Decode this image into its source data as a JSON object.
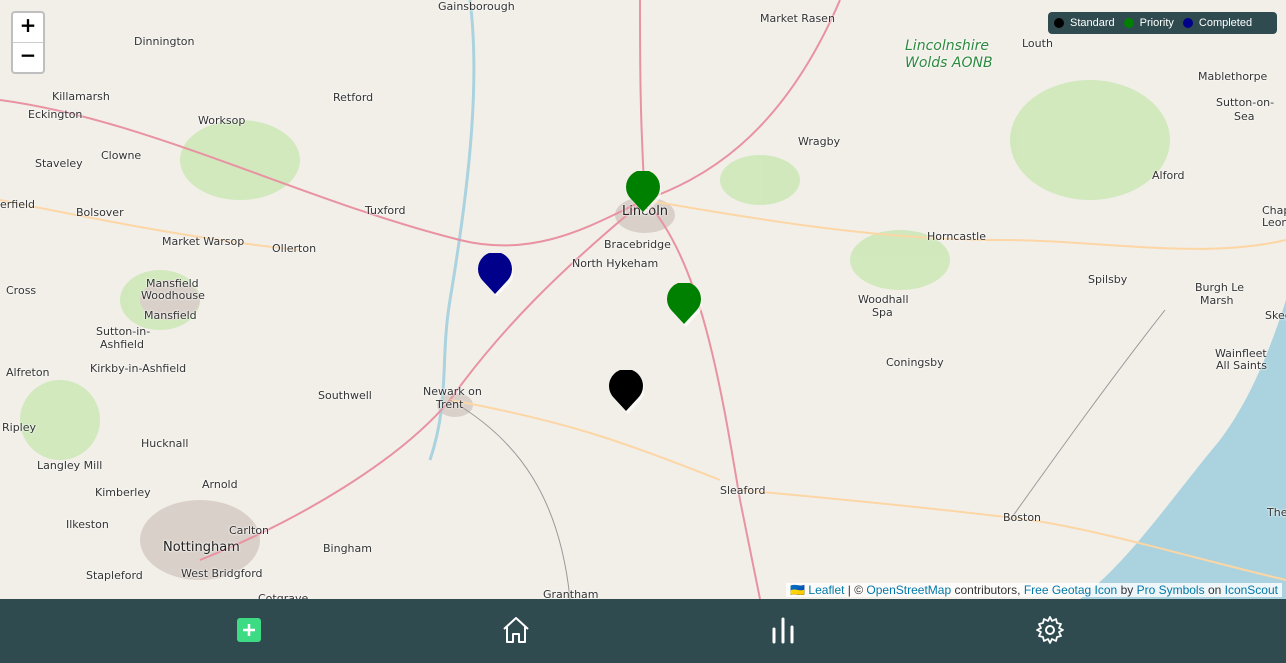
{
  "map": {
    "zoom_in": "+",
    "zoom_out": "−",
    "places": [
      {
        "name": "Gainsborough",
        "cls": ""
      },
      {
        "name": "Market Rasen",
        "cls": ""
      },
      {
        "name": "Louth",
        "cls": ""
      },
      {
        "name": "Lincolnshire",
        "cls": "park"
      },
      {
        "name": "Wolds AONB",
        "cls": "park"
      },
      {
        "name": "Mablethorpe",
        "cls": ""
      },
      {
        "name": "Sutton-on-",
        "cls": ""
      },
      {
        "name": "Sea",
        "cls": ""
      },
      {
        "name": "Dinnington",
        "cls": ""
      },
      {
        "name": "Killamarsh",
        "cls": ""
      },
      {
        "name": "Eckington",
        "cls": ""
      },
      {
        "name": "Worksop",
        "cls": ""
      },
      {
        "name": "Retford",
        "cls": ""
      },
      {
        "name": "Staveley",
        "cls": ""
      },
      {
        "name": "Clowne",
        "cls": ""
      },
      {
        "name": "Wragby",
        "cls": ""
      },
      {
        "name": "Alford",
        "cls": ""
      },
      {
        "name": "Chap",
        "cls": ""
      },
      {
        "name": "Leona",
        "cls": ""
      },
      {
        "name": "erfield",
        "cls": ""
      },
      {
        "name": "Bolsover",
        "cls": ""
      },
      {
        "name": "Tuxford",
        "cls": ""
      },
      {
        "name": "Lincoln",
        "cls": "big"
      },
      {
        "name": "Bracebridge",
        "cls": ""
      },
      {
        "name": "Horncastle",
        "cls": ""
      },
      {
        "name": "Market Warsop",
        "cls": ""
      },
      {
        "name": "Ollerton",
        "cls": ""
      },
      {
        "name": "North Hykeham",
        "cls": ""
      },
      {
        "name": "Spilsby",
        "cls": ""
      },
      {
        "name": "Mansfield",
        "cls": ""
      },
      {
        "name": "Woodhouse",
        "cls": ""
      },
      {
        "name": "Burgh Le",
        "cls": ""
      },
      {
        "name": "Marsh",
        "cls": ""
      },
      {
        "name": "Cross",
        "cls": ""
      },
      {
        "name": "Mansfield",
        "cls": ""
      },
      {
        "name": "Woodhall",
        "cls": ""
      },
      {
        "name": "Spa",
        "cls": ""
      },
      {
        "name": "Skeg",
        "cls": ""
      },
      {
        "name": "Sutton-in-",
        "cls": ""
      },
      {
        "name": "Ashfield",
        "cls": ""
      },
      {
        "name": "Wainfleet",
        "cls": ""
      },
      {
        "name": "All Saints",
        "cls": ""
      },
      {
        "name": "Coningsby",
        "cls": ""
      },
      {
        "name": "Alfreton",
        "cls": ""
      },
      {
        "name": "Kirkby-in-Ashfield",
        "cls": ""
      },
      {
        "name": "Southwell",
        "cls": ""
      },
      {
        "name": "Newark on",
        "cls": ""
      },
      {
        "name": "Trent",
        "cls": ""
      },
      {
        "name": "Ripley",
        "cls": ""
      },
      {
        "name": "Hucknall",
        "cls": ""
      },
      {
        "name": "Langley Mill",
        "cls": ""
      },
      {
        "name": "Arnold",
        "cls": ""
      },
      {
        "name": "Kimberley",
        "cls": ""
      },
      {
        "name": "Sleaford",
        "cls": ""
      },
      {
        "name": "Ilkeston",
        "cls": ""
      },
      {
        "name": "Carlton",
        "cls": ""
      },
      {
        "name": "Boston",
        "cls": ""
      },
      {
        "name": "Nottingham",
        "cls": "big"
      },
      {
        "name": "Bingham",
        "cls": ""
      },
      {
        "name": "Stapleford",
        "cls": ""
      },
      {
        "name": "West Bridgford",
        "cls": ""
      },
      {
        "name": "Cotgrave",
        "cls": ""
      },
      {
        "name": "Grantham",
        "cls": ""
      },
      {
        "name": "The",
        "cls": ""
      }
    ],
    "markers": [
      {
        "status": "Priority",
        "color": "#008000"
      },
      {
        "status": "Completed",
        "color": "#00008b"
      },
      {
        "status": "Priority",
        "color": "#008000"
      },
      {
        "status": "Standard",
        "color": "#000000"
      }
    ]
  },
  "legend": [
    {
      "label": "Standard",
      "color": "#000000"
    },
    {
      "label": "Priority",
      "color": "#008000"
    },
    {
      "label": "Completed",
      "color": "#00008b"
    }
  ],
  "attribution": {
    "flag": "🇺🇦",
    "leaflet": "Leaflet",
    "sep": " | © ",
    "osm": "OpenStreetMap",
    "contributors": " contributors, ",
    "icon": "Free Geotag Icon",
    "by": " by ",
    "author": "Pro Symbols",
    "on": " on ",
    "site": "IconScout"
  },
  "nav": {
    "add_color": "#3ddc84",
    "bg": "#2f4b4f"
  }
}
